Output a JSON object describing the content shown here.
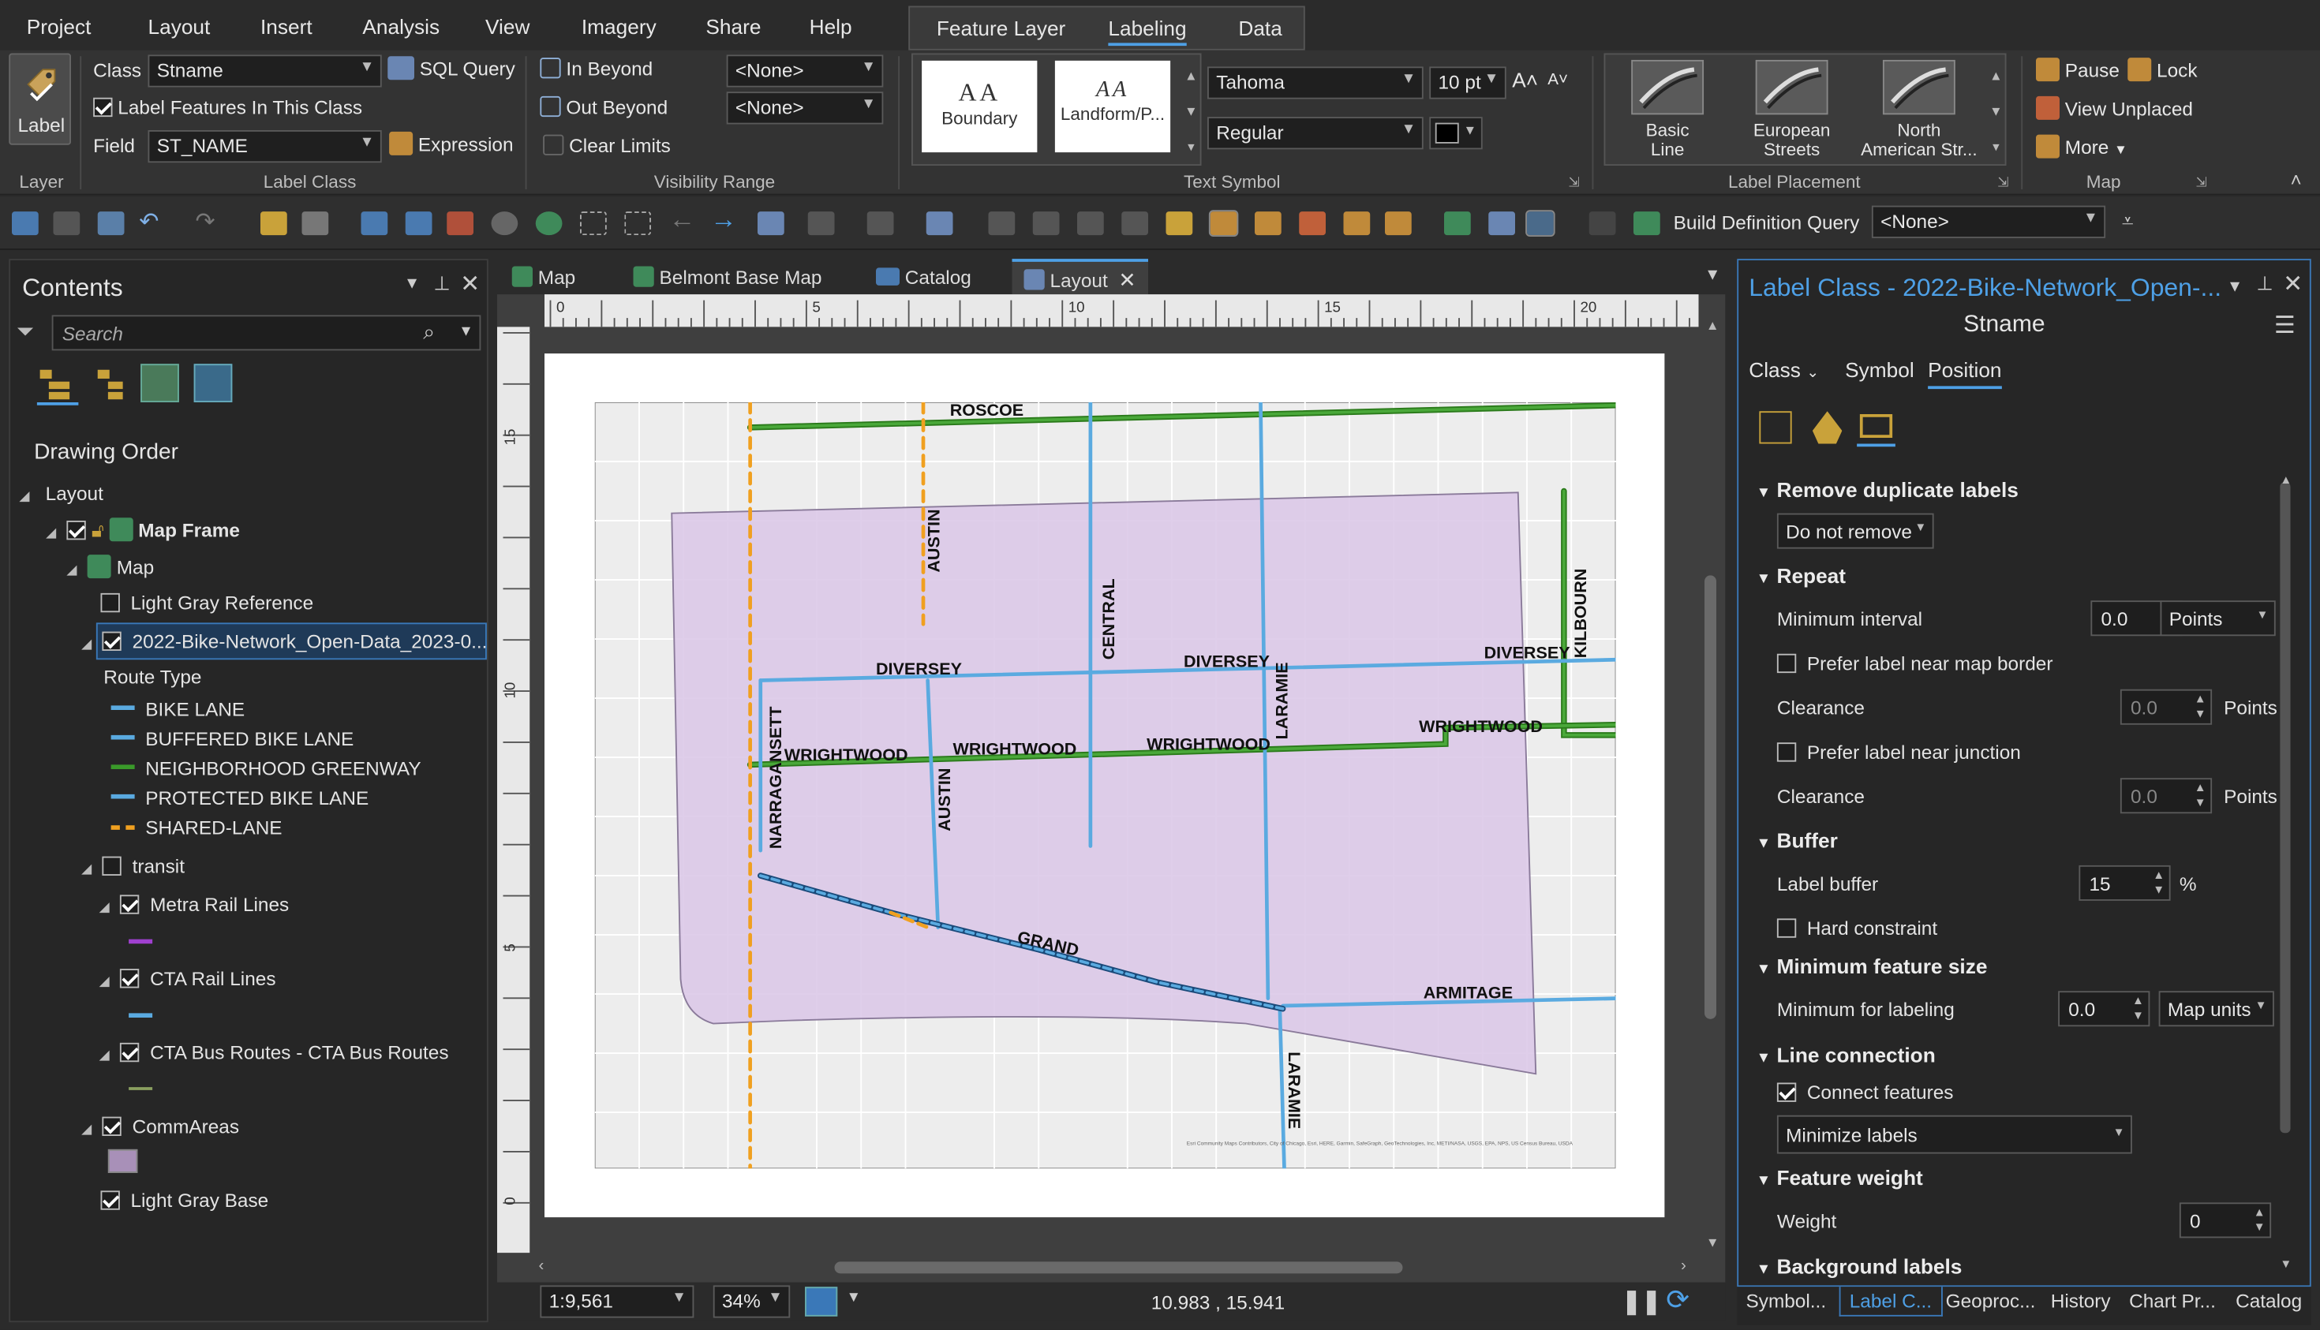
{
  "menu": [
    "Project",
    "Layout",
    "Insert",
    "Analysis",
    "View",
    "Imagery",
    "Share",
    "Help"
  ],
  "context_tabs": [
    "Feature Layer",
    "Labeling",
    "Data"
  ],
  "ribbon": {
    "label_btn": "Label",
    "layer_group": "Layer",
    "class_label": "Class",
    "class_value": "Stname",
    "sql_query": "SQL Query",
    "label_features": "Label Features In This Class",
    "field_label": "Field",
    "field_value": "ST_NAME",
    "expression": "Expression",
    "label_class_group": "Label Class",
    "in_beyond": "In Beyond",
    "out_beyond": "Out Beyond",
    "clear_limits": "Clear Limits",
    "none1": "<None>",
    "none2": "<None>",
    "visibility_group": "Visibility Range",
    "sym1_preview": "AA",
    "sym1_name": "Boundary",
    "sym2_preview": "AA",
    "sym2_name": "Landform/P...",
    "font": "Tahoma",
    "size": "10 pt",
    "style": "Regular",
    "text_symbol_group": "Text Symbol",
    "placement": [
      {
        "l1": "Basic",
        "l2": "Line"
      },
      {
        "l1": "European",
        "l2": "Streets"
      },
      {
        "l1": "North",
        "l2": "American Str..."
      }
    ],
    "label_placement_group": "Label Placement",
    "pause": "Pause",
    "lock": "Lock",
    "view_unplaced": "View Unplaced",
    "more": "More",
    "map_group": "Map"
  },
  "toolbar": {
    "build_def": "Build Definition Query",
    "def_value": "<None>"
  },
  "contents": {
    "title": "Contents",
    "search_placeholder": "Search",
    "drawing_order": "Drawing Order",
    "items": {
      "layout": "Layout",
      "map_frame": "Map Frame",
      "map": "Map",
      "light_gray_ref": "Light Gray Reference",
      "bike_layer": "2022-Bike-Network_Open-Data_2023-0...",
      "route_type": "Route Type",
      "route_classes": [
        "BIKE LANE",
        "BUFFERED BIKE LANE",
        "NEIGHBORHOOD GREENWAY",
        "PROTECTED BIKE LANE",
        "SHARED-LANE"
      ],
      "transit": "transit",
      "metra": "Metra Rail Lines",
      "cta_rail": "CTA Rail Lines",
      "cta_bus": "CTA Bus Routes - CTA Bus Routes",
      "commareas": "CommAreas",
      "light_gray_base": "Light Gray Base"
    }
  },
  "view_tabs": [
    "Map",
    "Belmont Base Map",
    "Catalog",
    "Layout"
  ],
  "ruler_h": [
    "0",
    "5",
    "10",
    "15",
    "20"
  ],
  "ruler_v": [
    "15",
    "10",
    "5",
    "0"
  ],
  "map_labels": {
    "roscoe": "ROSCOE",
    "austin": "AUSTIN",
    "central": "CENTRAL",
    "diversey": "DIVERSEY",
    "kilbourn": "KILBOURN",
    "laramie": "LARAMIE",
    "wrightwood": "WRIGHTWOOD",
    "narragansett": "NARRAGANSETT",
    "grand": "GRAND",
    "armitage": "ARMITAGE"
  },
  "attribution": "Esri Community Maps Contributors, City of Chicago, Esri, HERE, Garmin, SafeGraph, GeoTechnologies, Inc, METI/NASA, USGS, EPA, NPS, US Census Bureau, USDA",
  "status": {
    "scale": "1:9,561",
    "zoom": "34%",
    "coords": "10.983 , 15.941"
  },
  "label_pane": {
    "title": "Label Class - 2022-Bike-Network_Open-...",
    "subtitle": "Stname",
    "tabs": [
      "Class",
      "Symbol",
      "Position"
    ],
    "remove_dup": "Remove duplicate labels",
    "remove_dup_value": "Do not remove",
    "repeat": "Repeat",
    "min_interval": "Minimum interval",
    "min_interval_value": "0.0",
    "interval_units": "Points",
    "prefer_border": "Prefer label near map border",
    "clearance": "Clearance",
    "clearance_value": "0.0",
    "points": "Points",
    "prefer_junction": "Prefer label near junction",
    "buffer": "Buffer",
    "label_buffer": "Label buffer",
    "buffer_value": "15",
    "pct": "%",
    "hard_constraint": "Hard constraint",
    "min_feat": "Minimum feature size",
    "min_labeling": "Minimum for labeling",
    "min_value": "0.0",
    "map_units": "Map units",
    "line_conn": "Line connection",
    "connect": "Connect features",
    "minimize": "Minimize labels",
    "feat_weight": "Feature weight",
    "weight": "Weight",
    "weight_value": "0",
    "background": "Background labels"
  },
  "bottom_tabs": [
    "Symbol...",
    "Label C...",
    "Geoproc...",
    "History",
    "Chart Pr...",
    "Catalog"
  ]
}
